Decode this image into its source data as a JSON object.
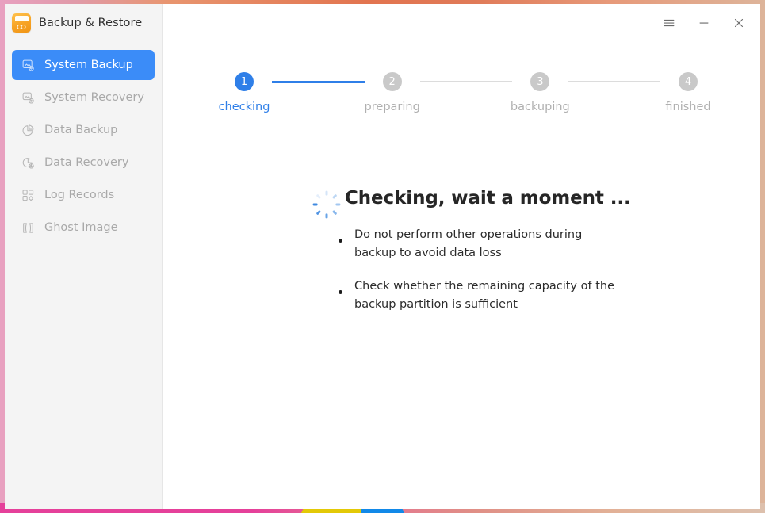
{
  "window": {
    "app_title": "Backup & Restore",
    "app_icon": "backup-restore-app-icon",
    "controls": {
      "menu_label": "☰",
      "menu_icon": "hamburger-menu-icon",
      "minimize_label": "–",
      "minimize_icon": "minimize-icon",
      "close_label": "✕",
      "close_icon": "close-icon"
    }
  },
  "sidebar": {
    "items": [
      {
        "label": "System Backup",
        "icon": "system-backup-icon",
        "active": true
      },
      {
        "label": "System Recovery",
        "icon": "system-recovery-icon",
        "active": false
      },
      {
        "label": "Data Backup",
        "icon": "data-backup-icon",
        "active": false
      },
      {
        "label": "Data Recovery",
        "icon": "data-recovery-icon",
        "active": false
      },
      {
        "label": "Log Records",
        "icon": "log-records-icon",
        "active": false
      },
      {
        "label": "Ghost Image",
        "icon": "ghost-image-icon",
        "active": false
      }
    ]
  },
  "stepper": {
    "current_step": 1,
    "steps": [
      {
        "number": "1",
        "label": "checking",
        "state": "active"
      },
      {
        "number": "2",
        "label": "preparing",
        "state": "inactive"
      },
      {
        "number": "3",
        "label": "backuping",
        "state": "inactive"
      },
      {
        "number": "4",
        "label": "finished",
        "state": "inactive"
      }
    ]
  },
  "status": {
    "spinner_icon": "loading-spinner-icon",
    "heading": "Checking, wait a moment ...",
    "notes": [
      "Do not perform other operations during backup to avoid data loss",
      "Check whether the remaining capacity of the backup partition is sufficient"
    ]
  },
  "colors": {
    "accent_blue": "#3b8cf8",
    "step_active_blue": "#2f7fe8",
    "step_inactive_gray": "#c9c9c9",
    "sidebar_bg": "#f4f4f4",
    "app_icon_orange": "#f7a325",
    "desktop_pink": "#e5409a"
  }
}
